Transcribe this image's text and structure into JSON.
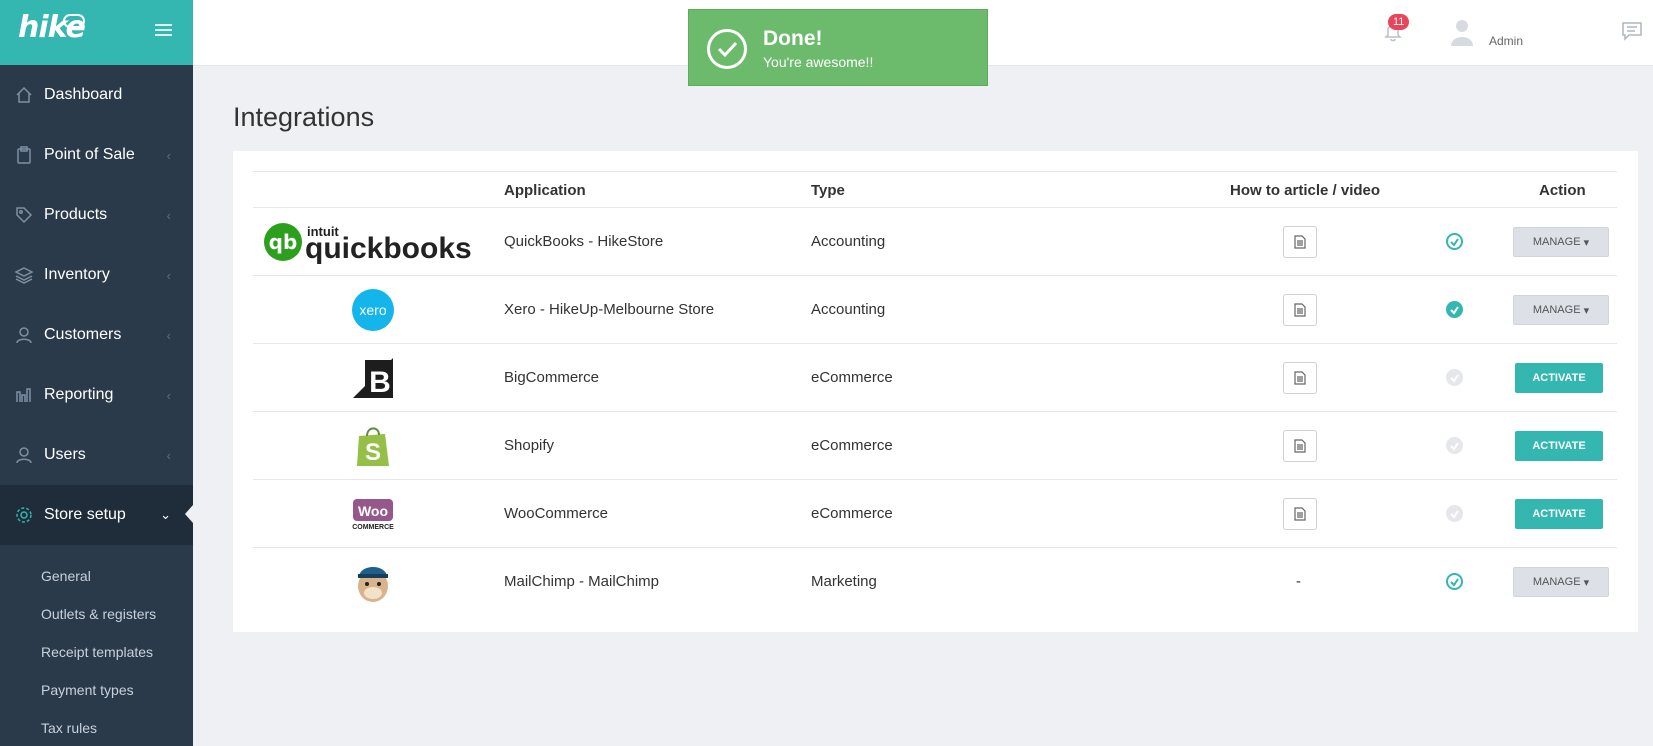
{
  "brand": {
    "name": "hike",
    "accent": "#34b6b1",
    "sidebar_bg": "#2b3a4a"
  },
  "sidebar": {
    "items": [
      {
        "label": "Dashboard",
        "icon": "home-icon"
      },
      {
        "label": "Point of Sale",
        "icon": "clipboard-icon"
      },
      {
        "label": "Products",
        "icon": "tag-icon"
      },
      {
        "label": "Inventory",
        "icon": "layers-icon"
      },
      {
        "label": "Customers",
        "icon": "user-icon"
      },
      {
        "label": "Reporting",
        "icon": "bar-chart-icon"
      },
      {
        "label": "Users",
        "icon": "user-icon"
      },
      {
        "label": "Store setup",
        "icon": "gear-icon"
      }
    ],
    "sub_items": [
      "General",
      "Outlets & registers",
      "Receipt templates",
      "Payment types",
      "Tax rules"
    ]
  },
  "header": {
    "notification_count": "11",
    "user_label": "Admin"
  },
  "toast": {
    "title": "Done!",
    "message": "You're awesome!!",
    "color": "#6cba6c"
  },
  "page": {
    "title": "Integrations"
  },
  "table": {
    "headers": {
      "application": "Application",
      "type": "Type",
      "howto": "How to article / video",
      "action": "Action"
    },
    "rows": [
      {
        "logo": "quickbooks-logo",
        "logo_brand": "quickbooks",
        "logo_brand_sup": "intuit",
        "application": "QuickBooks - HikeStore",
        "type": "Accounting",
        "howto": "doc",
        "status": "active",
        "action": "MANAGE"
      },
      {
        "logo": "xero-logo",
        "logo_brand": "xero",
        "application": "Xero - HikeUp-Melbourne Store",
        "type": "Accounting",
        "howto": "doc",
        "status": "active",
        "action": "MANAGE"
      },
      {
        "logo": "bigcommerce-logo",
        "logo_brand": "B",
        "application": "BigCommerce",
        "type": "eCommerce",
        "howto": "doc",
        "status": "inactive",
        "action": "ACTIVATE"
      },
      {
        "logo": "shopify-logo",
        "logo_brand": "S",
        "application": "Shopify",
        "type": "eCommerce",
        "howto": "doc",
        "status": "inactive",
        "action": "ACTIVATE"
      },
      {
        "logo": "woocommerce-logo",
        "logo_brand": "Woo",
        "logo_brand_sub": "COMMERCE",
        "application": "WooCommerce",
        "type": "eCommerce",
        "howto": "doc",
        "status": "inactive",
        "action": "ACTIVATE"
      },
      {
        "logo": "mailchimp-logo",
        "application": "MailChimp - MailChimp",
        "type": "Marketing",
        "howto": "-",
        "status": "active",
        "action": "MANAGE"
      }
    ]
  }
}
